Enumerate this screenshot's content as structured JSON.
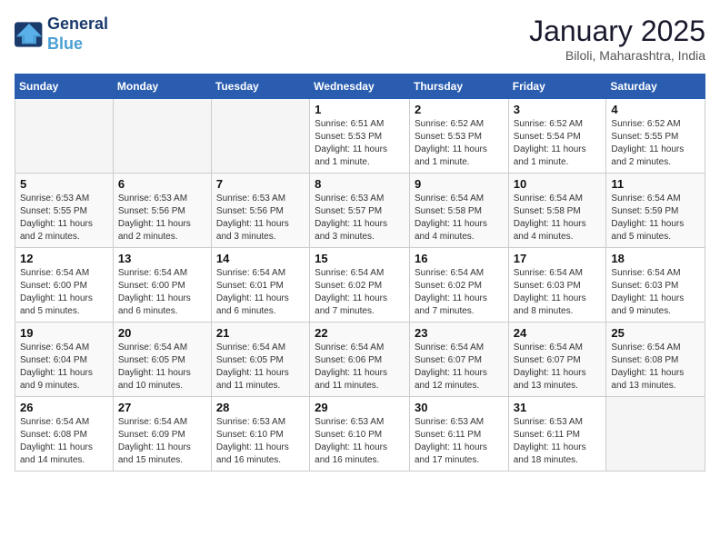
{
  "logo": {
    "line1": "General",
    "line2": "Blue"
  },
  "title": "January 2025",
  "subtitle": "Biloli, Maharashtra, India",
  "weekdays": [
    "Sunday",
    "Monday",
    "Tuesday",
    "Wednesday",
    "Thursday",
    "Friday",
    "Saturday"
  ],
  "weeks": [
    [
      {
        "day": "",
        "empty": true
      },
      {
        "day": "",
        "empty": true
      },
      {
        "day": "",
        "empty": true
      },
      {
        "day": "1",
        "info": "Sunrise: 6:51 AM\nSunset: 5:53 PM\nDaylight: 11 hours\nand 1 minute."
      },
      {
        "day": "2",
        "info": "Sunrise: 6:52 AM\nSunset: 5:53 PM\nDaylight: 11 hours\nand 1 minute."
      },
      {
        "day": "3",
        "info": "Sunrise: 6:52 AM\nSunset: 5:54 PM\nDaylight: 11 hours\nand 1 minute."
      },
      {
        "day": "4",
        "info": "Sunrise: 6:52 AM\nSunset: 5:55 PM\nDaylight: 11 hours\nand 2 minutes."
      }
    ],
    [
      {
        "day": "5",
        "info": "Sunrise: 6:53 AM\nSunset: 5:55 PM\nDaylight: 11 hours\nand 2 minutes."
      },
      {
        "day": "6",
        "info": "Sunrise: 6:53 AM\nSunset: 5:56 PM\nDaylight: 11 hours\nand 2 minutes."
      },
      {
        "day": "7",
        "info": "Sunrise: 6:53 AM\nSunset: 5:56 PM\nDaylight: 11 hours\nand 3 minutes."
      },
      {
        "day": "8",
        "info": "Sunrise: 6:53 AM\nSunset: 5:57 PM\nDaylight: 11 hours\nand 3 minutes."
      },
      {
        "day": "9",
        "info": "Sunrise: 6:54 AM\nSunset: 5:58 PM\nDaylight: 11 hours\nand 4 minutes."
      },
      {
        "day": "10",
        "info": "Sunrise: 6:54 AM\nSunset: 5:58 PM\nDaylight: 11 hours\nand 4 minutes."
      },
      {
        "day": "11",
        "info": "Sunrise: 6:54 AM\nSunset: 5:59 PM\nDaylight: 11 hours\nand 5 minutes."
      }
    ],
    [
      {
        "day": "12",
        "info": "Sunrise: 6:54 AM\nSunset: 6:00 PM\nDaylight: 11 hours\nand 5 minutes."
      },
      {
        "day": "13",
        "info": "Sunrise: 6:54 AM\nSunset: 6:00 PM\nDaylight: 11 hours\nand 6 minutes."
      },
      {
        "day": "14",
        "info": "Sunrise: 6:54 AM\nSunset: 6:01 PM\nDaylight: 11 hours\nand 6 minutes."
      },
      {
        "day": "15",
        "info": "Sunrise: 6:54 AM\nSunset: 6:02 PM\nDaylight: 11 hours\nand 7 minutes."
      },
      {
        "day": "16",
        "info": "Sunrise: 6:54 AM\nSunset: 6:02 PM\nDaylight: 11 hours\nand 7 minutes."
      },
      {
        "day": "17",
        "info": "Sunrise: 6:54 AM\nSunset: 6:03 PM\nDaylight: 11 hours\nand 8 minutes."
      },
      {
        "day": "18",
        "info": "Sunrise: 6:54 AM\nSunset: 6:03 PM\nDaylight: 11 hours\nand 9 minutes."
      }
    ],
    [
      {
        "day": "19",
        "info": "Sunrise: 6:54 AM\nSunset: 6:04 PM\nDaylight: 11 hours\nand 9 minutes."
      },
      {
        "day": "20",
        "info": "Sunrise: 6:54 AM\nSunset: 6:05 PM\nDaylight: 11 hours\nand 10 minutes."
      },
      {
        "day": "21",
        "info": "Sunrise: 6:54 AM\nSunset: 6:05 PM\nDaylight: 11 hours\nand 11 minutes."
      },
      {
        "day": "22",
        "info": "Sunrise: 6:54 AM\nSunset: 6:06 PM\nDaylight: 11 hours\nand 11 minutes."
      },
      {
        "day": "23",
        "info": "Sunrise: 6:54 AM\nSunset: 6:07 PM\nDaylight: 11 hours\nand 12 minutes."
      },
      {
        "day": "24",
        "info": "Sunrise: 6:54 AM\nSunset: 6:07 PM\nDaylight: 11 hours\nand 13 minutes."
      },
      {
        "day": "25",
        "info": "Sunrise: 6:54 AM\nSunset: 6:08 PM\nDaylight: 11 hours\nand 13 minutes."
      }
    ],
    [
      {
        "day": "26",
        "info": "Sunrise: 6:54 AM\nSunset: 6:08 PM\nDaylight: 11 hours\nand 14 minutes."
      },
      {
        "day": "27",
        "info": "Sunrise: 6:54 AM\nSunset: 6:09 PM\nDaylight: 11 hours\nand 15 minutes."
      },
      {
        "day": "28",
        "info": "Sunrise: 6:53 AM\nSunset: 6:10 PM\nDaylight: 11 hours\nand 16 minutes."
      },
      {
        "day": "29",
        "info": "Sunrise: 6:53 AM\nSunset: 6:10 PM\nDaylight: 11 hours\nand 16 minutes."
      },
      {
        "day": "30",
        "info": "Sunrise: 6:53 AM\nSunset: 6:11 PM\nDaylight: 11 hours\nand 17 minutes."
      },
      {
        "day": "31",
        "info": "Sunrise: 6:53 AM\nSunset: 6:11 PM\nDaylight: 11 hours\nand 18 minutes."
      },
      {
        "day": "",
        "empty": true
      }
    ]
  ]
}
